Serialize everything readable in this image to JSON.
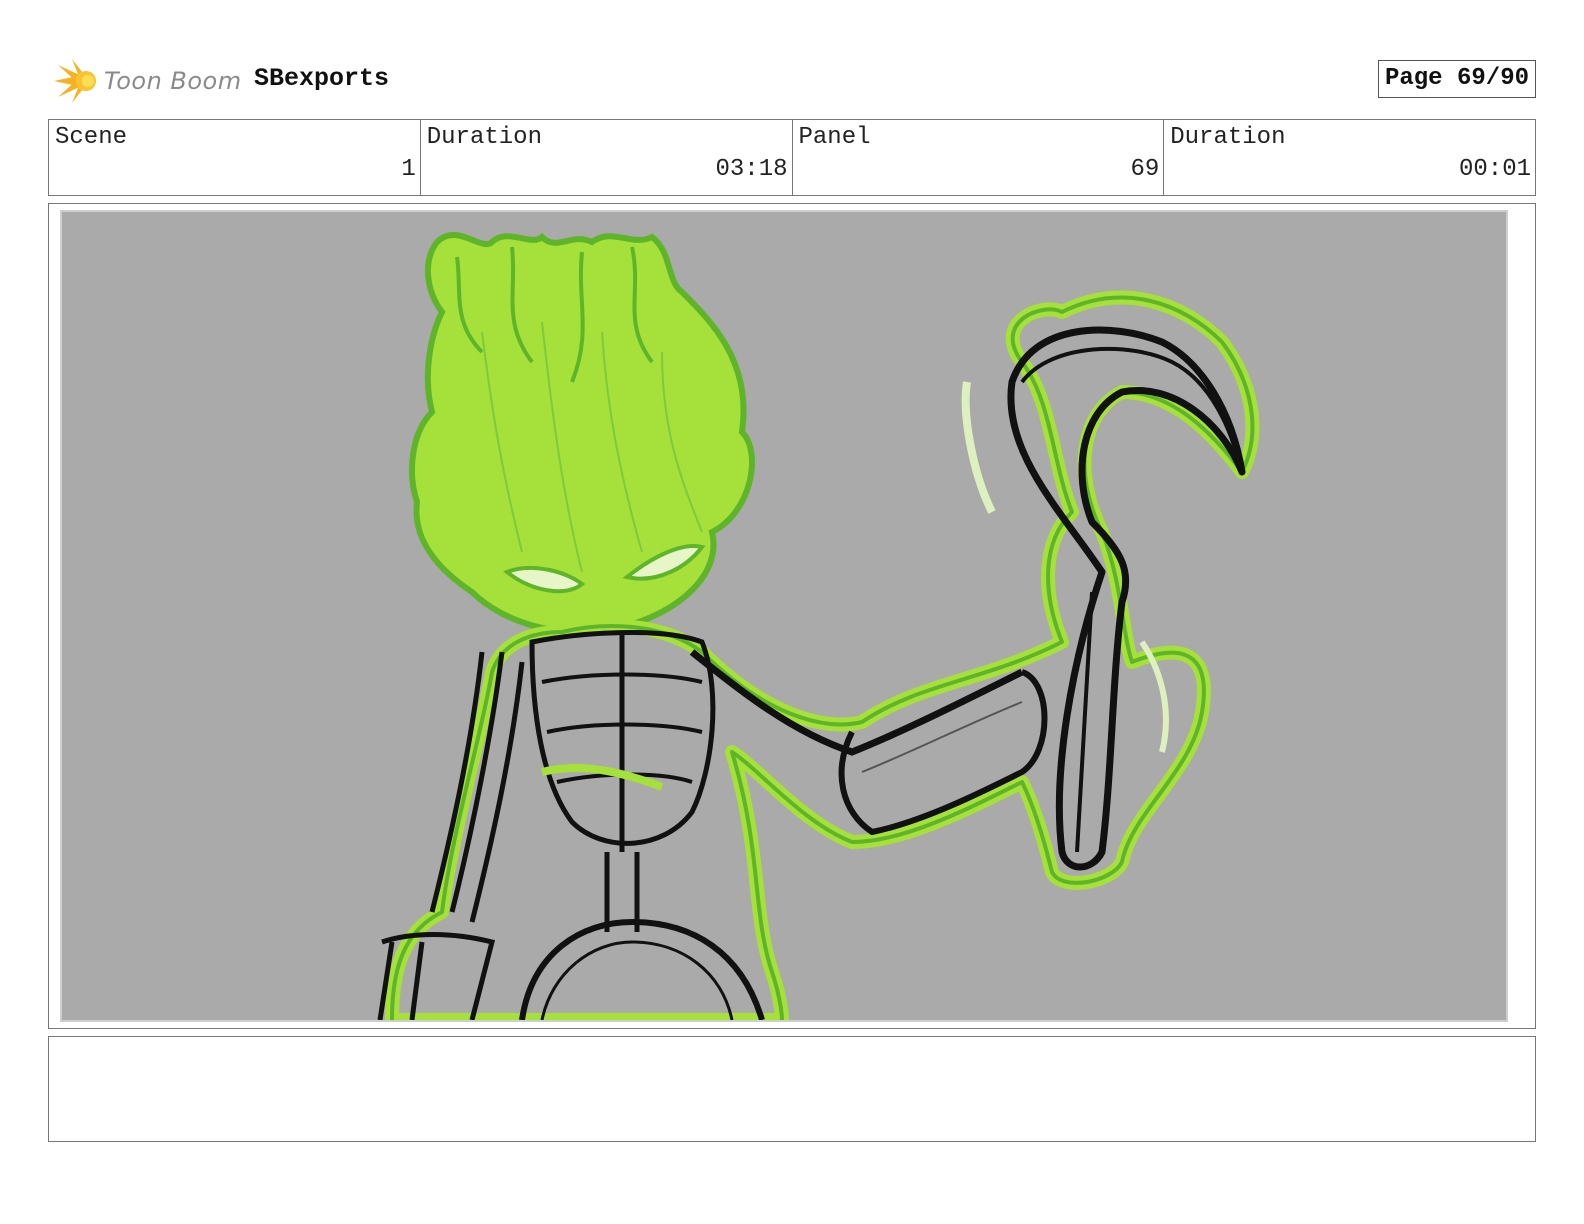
{
  "header": {
    "logo_text": "Toon Boom",
    "project_title": "SBexports",
    "page_label": "Page 69/90"
  },
  "info": {
    "scene_label": "Scene",
    "scene_value": "1",
    "scene_duration_label": "Duration",
    "scene_duration_value": "03:18",
    "panel_label": "Panel",
    "panel_value": "69",
    "panel_duration_label": "Duration",
    "panel_duration_value": "00:01"
  },
  "colors": {
    "panel_background": "#aaaaaa",
    "glow_green": "#a6e03a",
    "outline_green": "#5fb52a",
    "ink": "#111111",
    "logo_orange": "#f5a623"
  },
  "notes": {
    "text": ""
  }
}
